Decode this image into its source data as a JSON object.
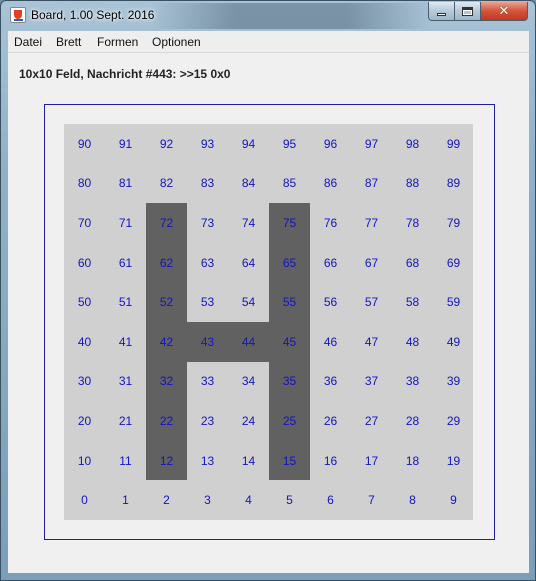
{
  "window": {
    "title": "Board, 1.00 Sept. 2016"
  },
  "menu": {
    "items": [
      {
        "label": "Datei"
      },
      {
        "label": "Brett"
      },
      {
        "label": "Formen"
      },
      {
        "label": "Optionen"
      }
    ]
  },
  "status": {
    "message": "10x10 Feld, Nachricht #443: >>15 0x0"
  },
  "board": {
    "rows": 10,
    "cols": 10,
    "cell_color": "#d0d0d0",
    "dark_color": "#616161",
    "label_color": "#1414c0",
    "frame_color": "#1f1f9f",
    "dark_cells": [
      12,
      15,
      22,
      25,
      32,
      35,
      42,
      43,
      44,
      45,
      52,
      55,
      62,
      65,
      72,
      75
    ]
  }
}
